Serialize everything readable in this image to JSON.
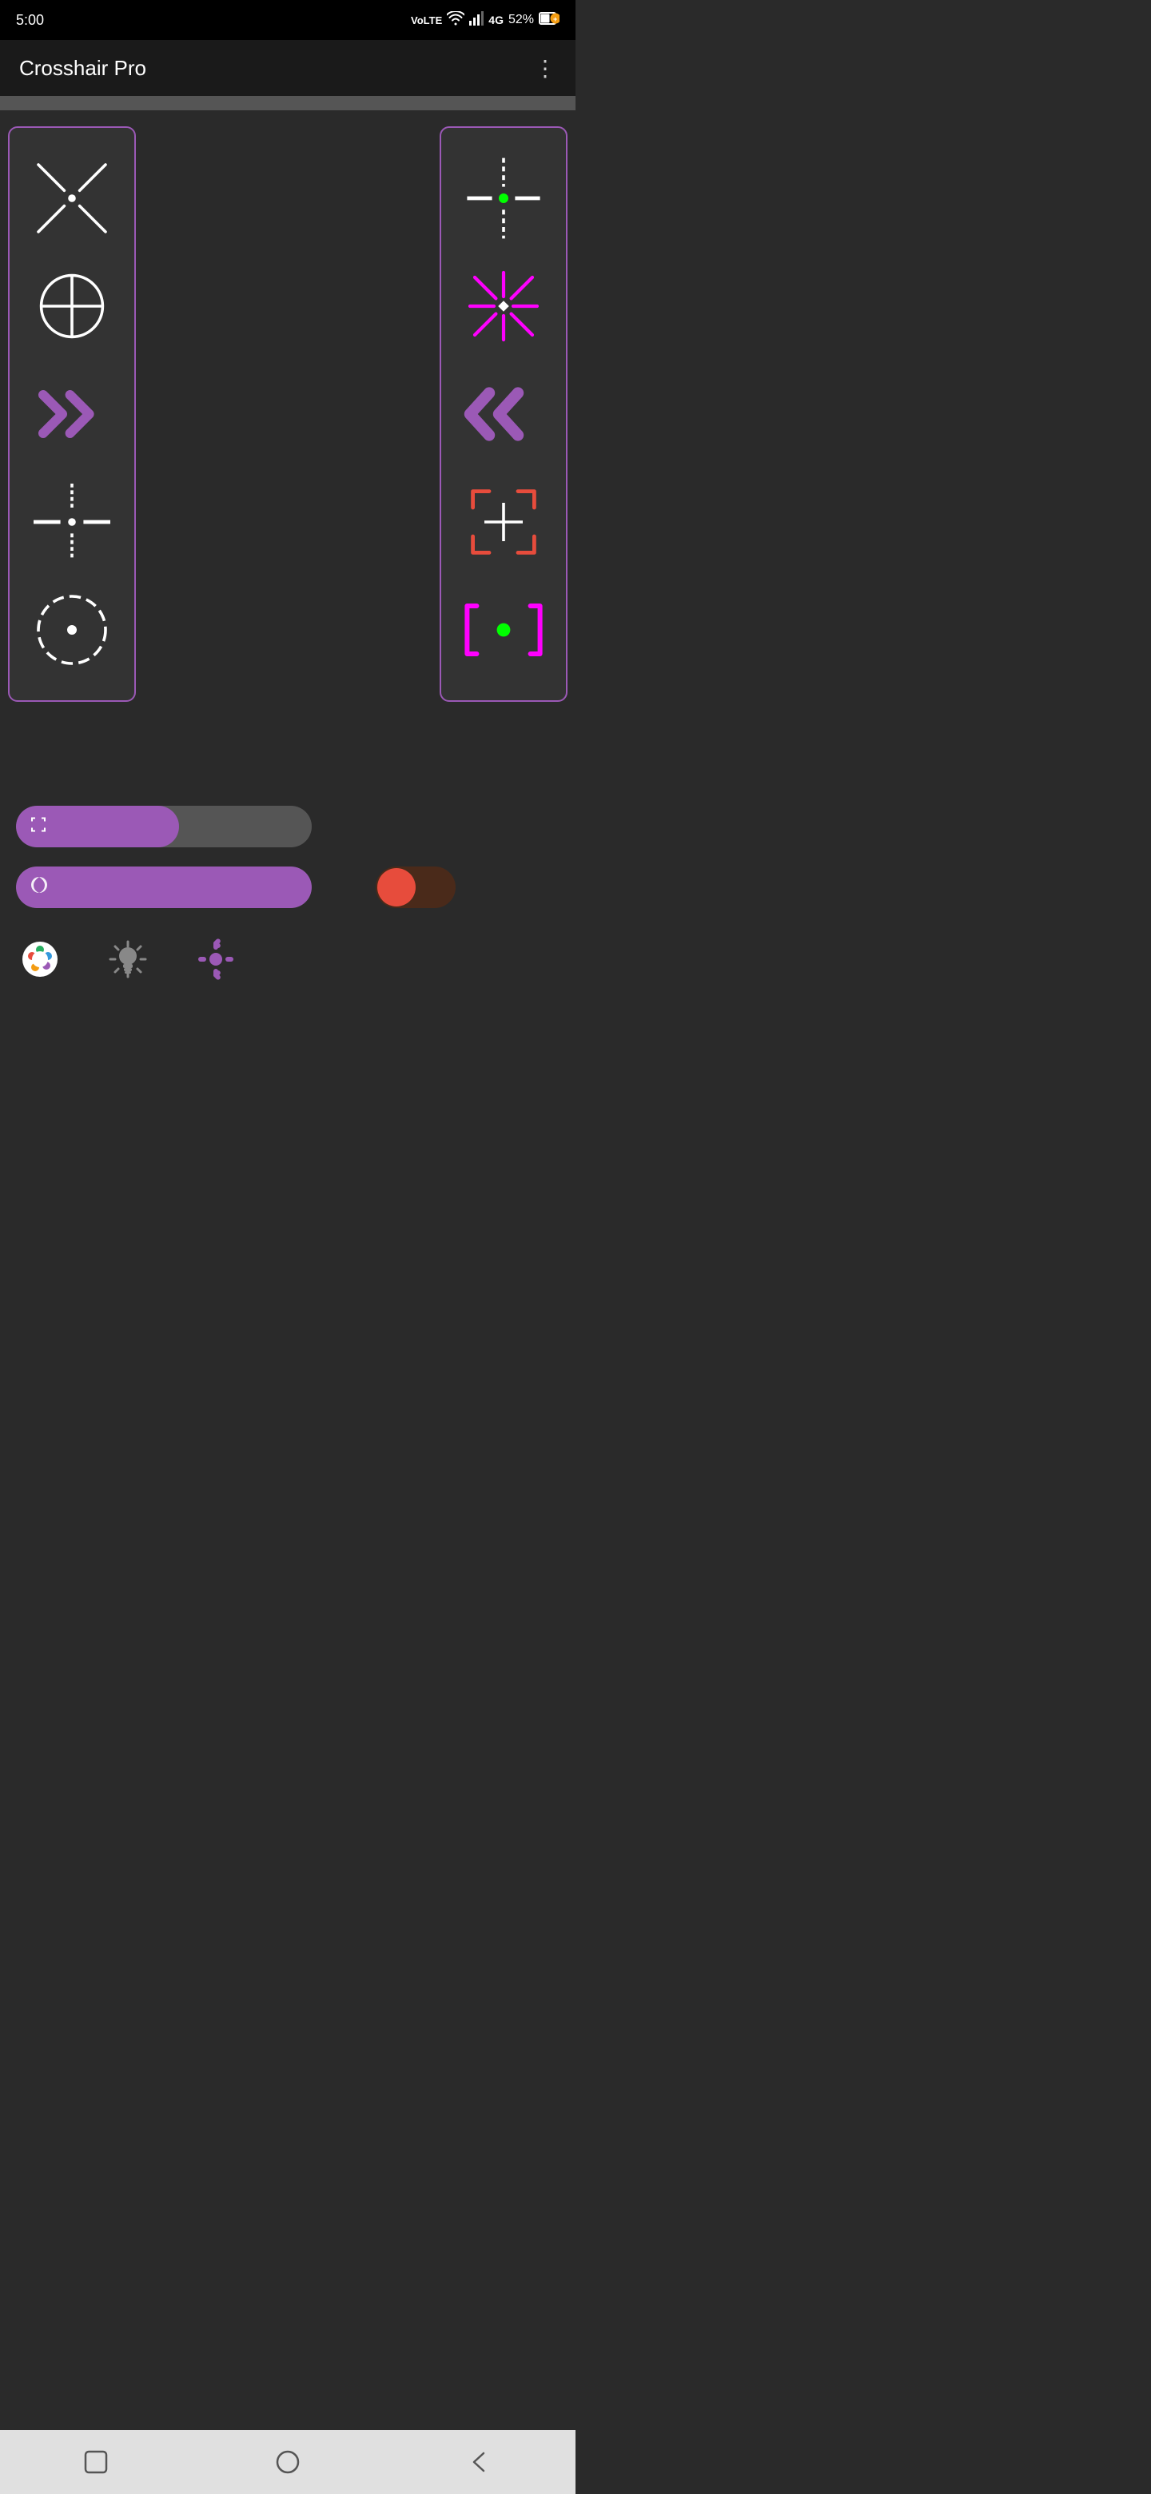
{
  "statusBar": {
    "time": "5:00",
    "battery": "52%",
    "icons": [
      "volte",
      "wifi",
      "signal"
    ]
  },
  "appBar": {
    "title": "Crosshair Pro",
    "menuIcon": "⋮"
  },
  "crosshairs": {
    "left": [
      {
        "id": "ch-x",
        "label": "X crosshair"
      },
      {
        "id": "ch-circle",
        "label": "Circle crosshair"
      },
      {
        "id": "ch-chevron",
        "label": "Chevron crosshair"
      },
      {
        "id": "ch-plus-dot",
        "label": "Plus dot crosshair"
      },
      {
        "id": "ch-circle-dot",
        "label": "Circle dot crosshair"
      }
    ],
    "right": [
      {
        "id": "ch-dashed-plus",
        "label": "Dashed plus crosshair"
      },
      {
        "id": "ch-star",
        "label": "Star crosshair"
      },
      {
        "id": "ch-double-chevron",
        "label": "Double chevron crosshair"
      },
      {
        "id": "ch-bracket-plus",
        "label": "Bracket plus crosshair"
      },
      {
        "id": "ch-bracket-dot",
        "label": "Bracket dot crosshair"
      }
    ]
  },
  "controls": {
    "sizeSlider": {
      "label": "Size",
      "value": 55,
      "icon": "⤢"
    },
    "opacitySlider": {
      "label": "Opacity",
      "value": 100,
      "icon": "🔵"
    },
    "toggle": {
      "label": "Toggle",
      "enabled": false
    },
    "bottomIcons": {
      "palette": "🎨",
      "brightness": "💡",
      "settings": "⚙"
    }
  },
  "navBar": {
    "square": "□",
    "circle": "○",
    "back": "◁"
  }
}
